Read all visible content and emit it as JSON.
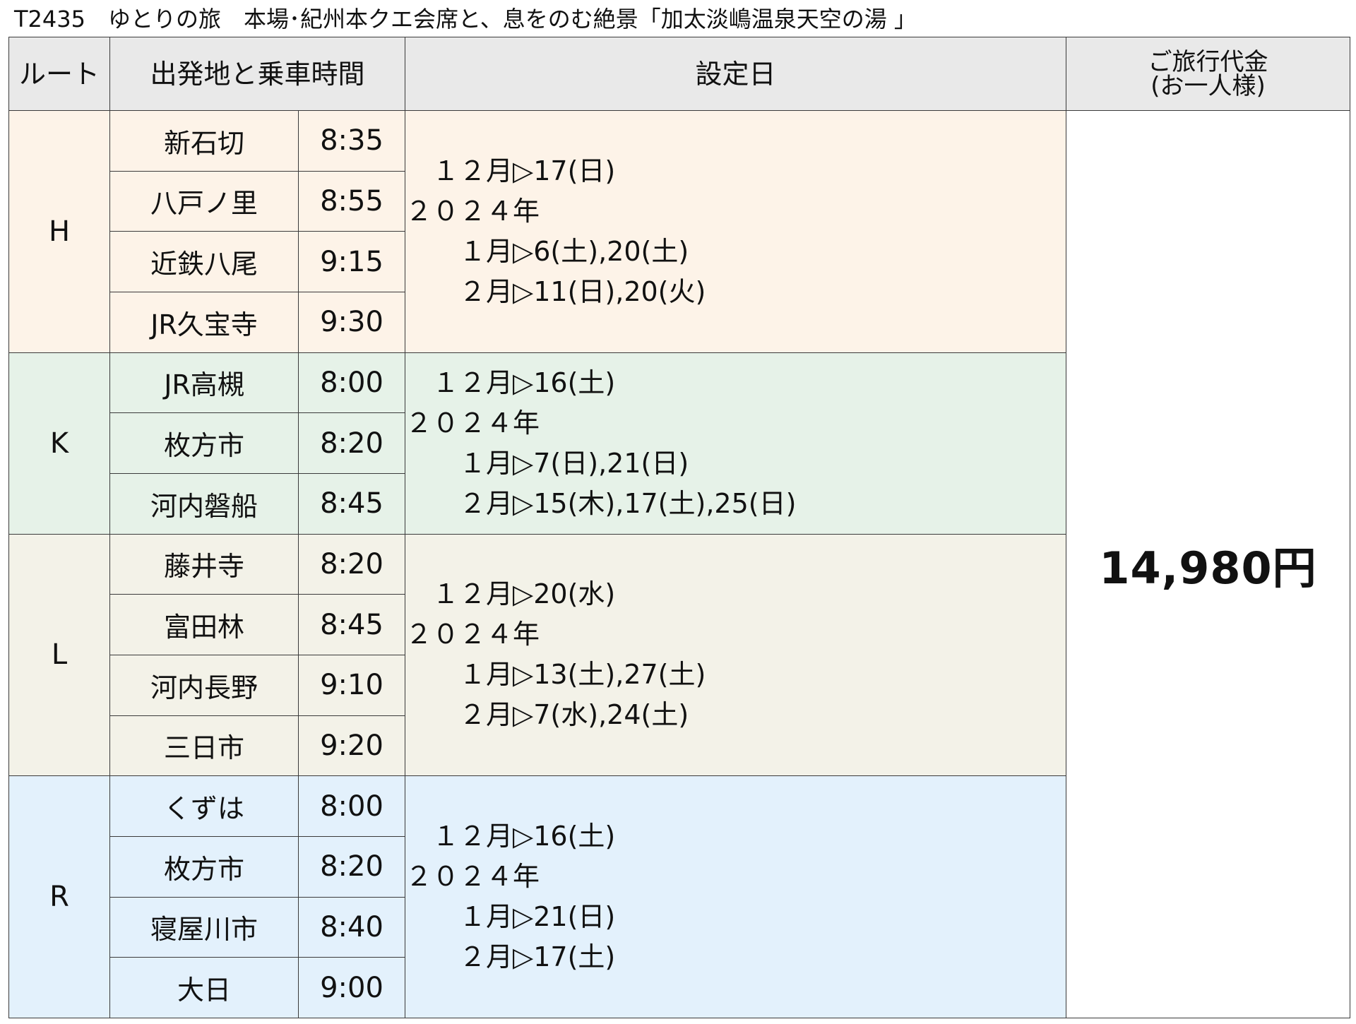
{
  "title": "T2435　ゆとりの旅　本場･紀州本クエ会席と、息をのむ絶景「加太淡嶋温泉天空の湯 」",
  "header": {
    "route": "ルート",
    "departure": "出発地と乗車時間",
    "dates": "設定日",
    "price_line1": "ご旅行代金",
    "price_line2": "(お一人様)"
  },
  "price": "14,980円",
  "routes": [
    {
      "code": "H",
      "stops": [
        {
          "place": "新石切",
          "time": "8:35"
        },
        {
          "place": "八戸ノ里",
          "time": "8:55"
        },
        {
          "place": "近鉄八尾",
          "time": "9:15"
        },
        {
          "place": "JR久宝寺",
          "time": "9:30"
        }
      ],
      "dates": [
        "　１２月▷17(日)",
        "２０２４年",
        "　　１月▷6(土),20(土)",
        "　　２月▷11(日),20(火)"
      ]
    },
    {
      "code": "K",
      "stops": [
        {
          "place": "JR高槻",
          "time": "8:00"
        },
        {
          "place": "枚方市",
          "time": "8:20"
        },
        {
          "place": "河内磐船",
          "time": "8:45"
        }
      ],
      "dates": [
        "　１２月▷16(土)",
        "２０２４年",
        "　　１月▷7(日),21(日)",
        "　　２月▷15(木),17(土),25(日)"
      ]
    },
    {
      "code": "L",
      "stops": [
        {
          "place": "藤井寺",
          "time": "8:20"
        },
        {
          "place": "富田林",
          "time": "8:45"
        },
        {
          "place": "河内長野",
          "time": "9:10"
        },
        {
          "place": "三日市",
          "time": "9:20"
        }
      ],
      "dates": [
        "　１２月▷20(水)",
        "２０２４年",
        "　　１月▷13(土),27(土)",
        "　　２月▷7(水),24(土)"
      ]
    },
    {
      "code": "R",
      "stops": [
        {
          "place": "くずは",
          "time": "8:00"
        },
        {
          "place": "枚方市",
          "time": "8:20"
        },
        {
          "place": "寝屋川市",
          "time": "8:40"
        },
        {
          "place": "大日",
          "time": "9:00"
        }
      ],
      "dates": [
        "　１２月▷16(土)",
        "２０２４年",
        "　　１月▷21(日)",
        "　　２月▷17(土)"
      ]
    }
  ]
}
